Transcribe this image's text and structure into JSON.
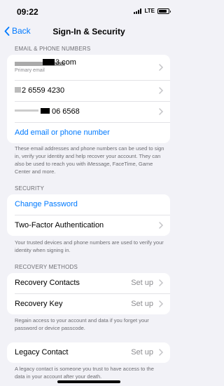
{
  "status": {
    "time": "09:22",
    "network": "LTE"
  },
  "nav": {
    "back_label": "Back",
    "title": "Sign-In & Security"
  },
  "email_section": {
    "header": "EMAIL & PHONE NUMBERS",
    "rows": [
      {
        "value": "3.com",
        "sublabel": "Primary email"
      },
      {
        "value": "2 6559 4230"
      },
      {
        "value": "06 6568"
      }
    ],
    "add_label": "Add email or phone number",
    "footer": "These email addresses and phone numbers can be used to sign in, verify your identity and help recover your account. They can also be used to reach you with iMessage, FaceTime, Game Center and more."
  },
  "security_section": {
    "header": "SECURITY",
    "change_password": "Change Password",
    "two_factor": "Two-Factor Authentication",
    "footer": "Your trusted devices and phone numbers are used to verify your identity when signing in."
  },
  "recovery_section": {
    "header": "RECOVERY METHODS",
    "contacts_label": "Recovery Contacts",
    "contacts_value": "Set up",
    "key_label": "Recovery Key",
    "key_value": "Set up",
    "footer": "Regain access to your account and data if you forget your password or device passcode."
  },
  "legacy_section": {
    "label": "Legacy Contact",
    "value": "Set up",
    "footer": "A legacy contact is someone you trust to have access to the data in your account after your death."
  }
}
